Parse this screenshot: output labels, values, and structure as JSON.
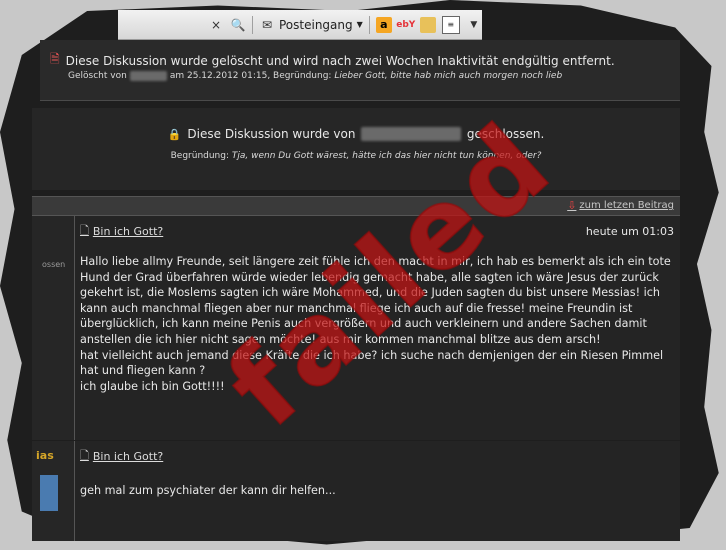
{
  "toolbar": {
    "close_glyph": "×",
    "search_glyph": "🔍",
    "mail_label": "Posteingang",
    "amazon_glyph": "a",
    "ebay_glyph": "ebY",
    "menu_glyph": "▼"
  },
  "notice_deleted": {
    "title": "Diese Diskussion wurde gelöscht und wird nach zwei Wochen Inaktivität endgültig entfernt.",
    "deleted_by_prefix": "Gelöscht von",
    "deleted_by_user": "xxxxxxx",
    "deleted_by_suffix": "am 25.12.2012 01:15, Begründung:",
    "reason": "Lieber Gott, bitte hab mich auch morgen noch lieb"
  },
  "notice_closed": {
    "title_prefix": "Diese Diskussion wurde von",
    "title_user": "xxxxxxxxxxxxxx",
    "title_suffix": "geschlossen.",
    "reason_label": "Begründung:",
    "reason": "Tja, wenn Du Gott wärest, hätte ich das hier nicht tun können, oder?"
  },
  "nav": {
    "last_post": "zum letzen Beitrag"
  },
  "posts": [
    {
      "side_text": "ossen",
      "title": "Bin ich Gott?",
      "date": "heute um 01:03",
      "body": "Hallo liebe allmy Freunde, seit längere zeit fühle ich den macht in mir, ich hab es bemerkt als ich ein tote Hund der Grad überfahren würde wieder lebendig gemacht habe, alle sagten ich wäre Jesus der zurück gekehrt ist, die Moslems sagten ich wäre Mohammed, und die Juden sagten du bist unsere Messias! ich kann auch manchmal fliegen aber nur manchmal fliege ich auch auf die fresse! meine Freundin ist überglücklich, ich kann meine Penis auch vergrößern und auch verkleinern und andere Sachen damit anstellen die ich hier nicht sagen möchte! aus mir kommen manchmal blitze aus dem arsch!\nhat vielleicht auch jemand diese Kräfte die ich habe? ich suche nach demjenigen der ein Riesen Pimmel hat und fliegen kann ?\nich glaube ich bin Gott!!!!"
    },
    {
      "side_text": "ias",
      "title": "Bin ich Gott?",
      "body": "geh mal zum psychiater der kann dir helfen..."
    }
  ],
  "stamp": {
    "text": "failed",
    "color": "#c41414"
  },
  "colors": {
    "background": "#1e1e1e",
    "text": "#e8e8e8",
    "accent": "#d6a628"
  }
}
